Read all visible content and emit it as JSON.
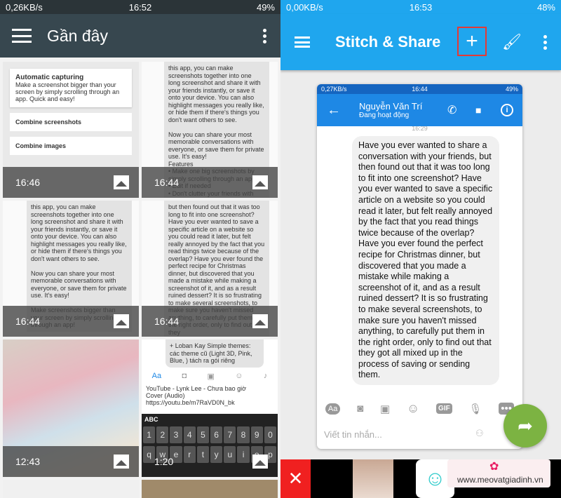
{
  "left": {
    "status": {
      "speed": "0,26KB/s",
      "time": "16:52",
      "battery": "49%"
    },
    "title": "Gần đây",
    "tiles": [
      {
        "time": "16:46",
        "lines": [
          "Automatic capturing",
          "Make a screenshot bigger than your screen by simply scrolling through an app. Quick and easy!",
          "Combine screenshots",
          "Combine images"
        ]
      },
      {
        "time": "16:44",
        "text": "this app, you can make screenshots together into one long screenshot and share it with your friends instantly, or save it onto your device. You can also highlight messages you really like, or hide them if there's things you don't want others to see.\n\nNow you can share your most memorable conversations with everyone, or save them for private use. It's easy!\nFeatures\n• Make one big screenshots by simply scrolling through an app\n• Edit if needed\n• Don't clutter your friends with"
      },
      {
        "time": "16:44",
        "text": "this app, you can make screenshots together into one long screenshot and share it with your friends instantly, or save it onto your device. You can also highlight messages you really like, or hide them if there's things you don't want others to see.\n\nNow you can share your most memorable conversations with everyone, or save them for private use. It's easy!\n\nMake screenshots bigger than your screen by simply scrolling through an app!"
      },
      {
        "time": "16:44",
        "text": "but then found out that it was too long to fit into one screenshot? Have you ever wanted to save a specific article on a website so you could read it later, but felt really annoyed by the fact that you read things twice because of the overlap? Have you ever found the perfect recipe for Christmas dinner, but discovered that you made a mistake while making a screenshot of it, and as a result ruined dessert? It is so frustrating to make several screenshots, to make sure you haven't missed anything, to carefully put them in the right order, only to find out that they"
      },
      {
        "time": "12:43"
      },
      {
        "time": "1:20",
        "chat": "+ Loban Kay Simple themes: các theme cũ (Light 3D, Pink, Blue, ) tách ra gói riêng",
        "input": "YouTube - Lynk Lee - Chưa bao giờ Cover (Audio) https://youtu.be/m7RaVD0N_bk",
        "kb_tab": "ABC",
        "keys": [
          "1",
          "2",
          "3",
          "4",
          "5",
          "6",
          "7",
          "8",
          "9",
          "0"
        ],
        "letters": [
          "q",
          "w",
          "e",
          "r",
          "t",
          "y",
          "u",
          "i",
          "o",
          "p"
        ]
      }
    ]
  },
  "right": {
    "status": {
      "speed": "0,00KB/s",
      "time": "16:53",
      "battery": "48%"
    },
    "title": "Stitch & Share",
    "highlight_color": "#e53935",
    "card": {
      "status": {
        "speed": "0,27KB/s",
        "time": "16:44",
        "battery": "49%"
      },
      "contact": "Nguyễn Văn Trí",
      "presence": "Đang hoạt động",
      "timestamp": "16:29",
      "message": "Have you ever wanted to share a conversation with your friends, but then found out that it was too long to fit into one screenshot? Have you ever wanted to save a specific article on a website so you could read it later, but felt really annoyed by the fact that you read things twice because of the overlap? Have you ever found the perfect recipe for Christmas dinner, but discovered that you made a mistake while making a screenshot of it, and as a result ruined dessert? It is so frustrating to make several screenshots, to make sure you haven't missed anything, to carefully put them in the right order, only to find out that they got all mixed up in the process of saving or sending them.",
      "aa": "Aa",
      "gif": "GIF",
      "placeholder": "Viết tin nhắn..."
    },
    "watermark": "www.meovatgiadinh.vn"
  }
}
